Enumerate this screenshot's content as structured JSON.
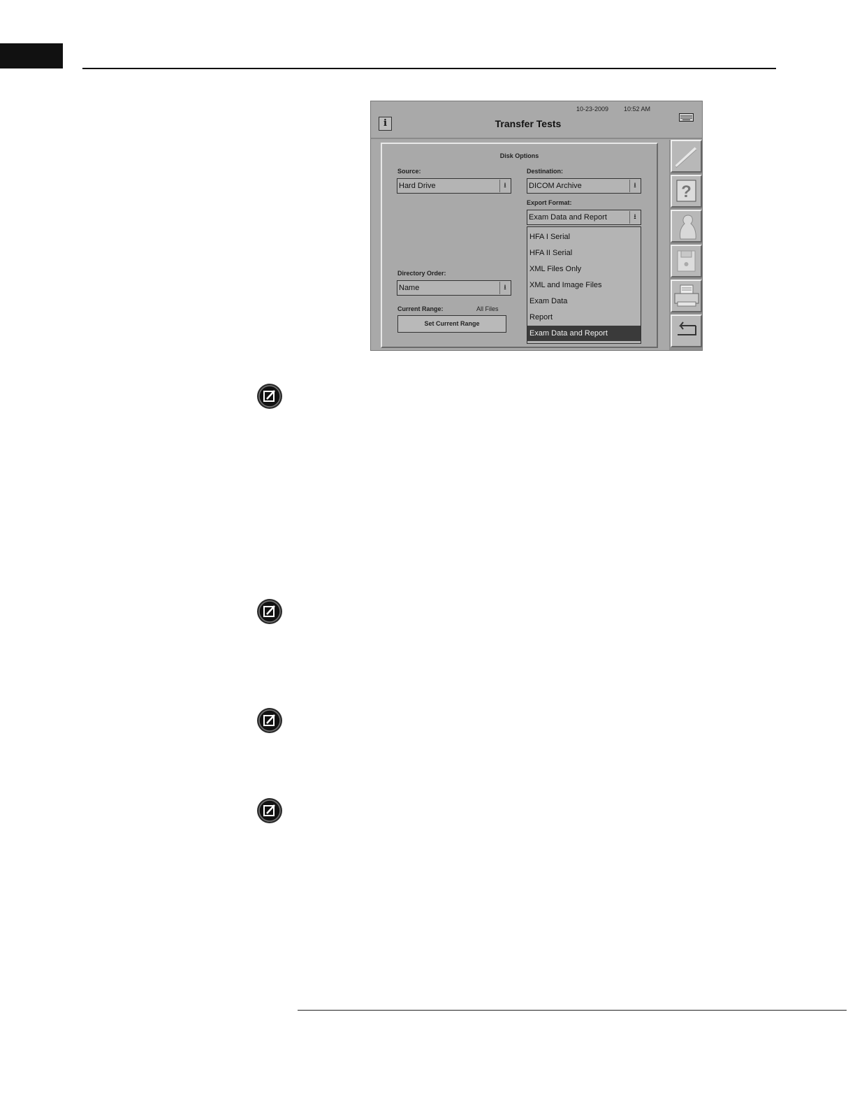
{
  "screen": {
    "date": "10-23-2009",
    "time": "10:52 AM",
    "title": "Transfer Tests",
    "info_button": "i",
    "panel_title": "Disk Options",
    "source_label": "Source:",
    "source_value": "Hard Drive",
    "destination_label": "Destination:",
    "destination_value": "DICOM Archive",
    "export_format_label": "Export Format:",
    "export_format_value": "Exam Data and Report",
    "export_options": [
      "HFA I Serial",
      "HFA II Serial",
      "XML Files Only",
      "XML and Image Files",
      "Exam Data",
      "Report",
      "Exam Data and Report"
    ],
    "selected_option": "Exam Data and Report",
    "directory_order_label": "Directory Order:",
    "directory_order_value": "Name",
    "current_range_label": "Current Range:",
    "current_range_value": "All Files",
    "set_range_button": "Set Current Range",
    "sidebar_buttons": [
      "pen-icon",
      "help-icon",
      "patient-icon",
      "disk-icon",
      "printer-icon",
      "return-icon"
    ]
  },
  "notes": [
    "note-icon",
    "note-icon",
    "note-icon",
    "note-icon"
  ]
}
